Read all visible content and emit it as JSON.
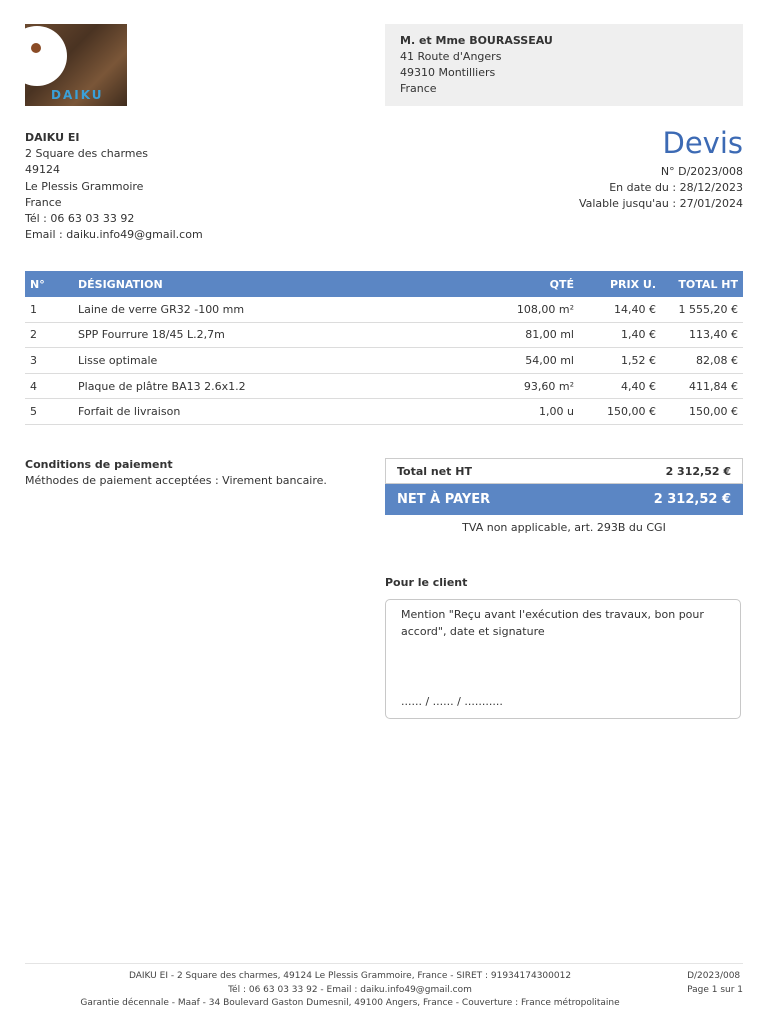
{
  "logo": {
    "text": "DAIKU"
  },
  "recipient": {
    "name": "M. et Mme BOURASSEAU",
    "address": "41 Route d'Angers",
    "city": "49310 Montilliers",
    "country": "France"
  },
  "sender": {
    "name": "DAIKU EI",
    "address": "2 Square des charmes",
    "postcode": "49124",
    "city": "Le Plessis Grammoire",
    "country": "France",
    "phone": "Tél : 06 63 03 33 92",
    "email": "Email : daiku.info49@gmail.com"
  },
  "document": {
    "title": "Devis",
    "number": "N° D/2023/008",
    "date": "En date du : 28/12/2023",
    "valid_until": "Valable jusqu'au : 27/01/2024"
  },
  "table": {
    "headers": {
      "num": "N°",
      "designation": "DÉSIGNATION",
      "qty": "QTÉ",
      "unit_price": "PRIX U.",
      "total": "TOTAL HT"
    },
    "rows": [
      {
        "num": "1",
        "designation": "Laine de verre GR32 -100 mm",
        "qty": "108,00 m²",
        "unit_price": "14,40 €",
        "total": "1 555,20 €"
      },
      {
        "num": "2",
        "designation": "SPP Fourrure 18/45 L.2,7m",
        "qty": "81,00 ml",
        "unit_price": "1,40 €",
        "total": "113,40 €"
      },
      {
        "num": "3",
        "designation": "Lisse optimale",
        "qty": "54,00 ml",
        "unit_price": "1,52 €",
        "total": "82,08 €"
      },
      {
        "num": "4",
        "designation": "Plaque de plâtre BA13 2.6x1.2",
        "qty": "93,60 m²",
        "unit_price": "4,40 €",
        "total": "411,84 €"
      },
      {
        "num": "5",
        "designation": "Forfait de livraison",
        "qty": "1,00 u",
        "unit_price": "150,00 €",
        "total": "150,00 €"
      }
    ]
  },
  "payment": {
    "title": "Conditions de paiement",
    "text": "Méthodes de paiement acceptées : Virement bancaire."
  },
  "totals": {
    "net_ht_label": "Total net HT",
    "net_ht_value": "2 312,52 €",
    "net_pay_label": "NET À PAYER",
    "net_pay_value": "2 312,52 €",
    "tva_note": "TVA non applicable, art. 293B du CGI"
  },
  "client": {
    "title": "Pour le client",
    "mention": "Mention \"Reçu avant l'exécution des travaux, bon pour accord\", date et signature",
    "date_placeholder": "...... / ...... / ..........."
  },
  "footer": {
    "line1": "DAIKU EI - 2 Square des charmes, 49124 Le Plessis Grammoire, France - SIRET : 91934174300012",
    "line2": "Tél : 06 63 03 33 92 - Email : daiku.info49@gmail.com",
    "line3": "Garantie décennale - Maaf - 34 Boulevard Gaston Dumesnil, 49100 Angers, France - Couverture : France métropolitaine",
    "ref": "D/2023/008",
    "page": "Page 1 sur 1"
  }
}
